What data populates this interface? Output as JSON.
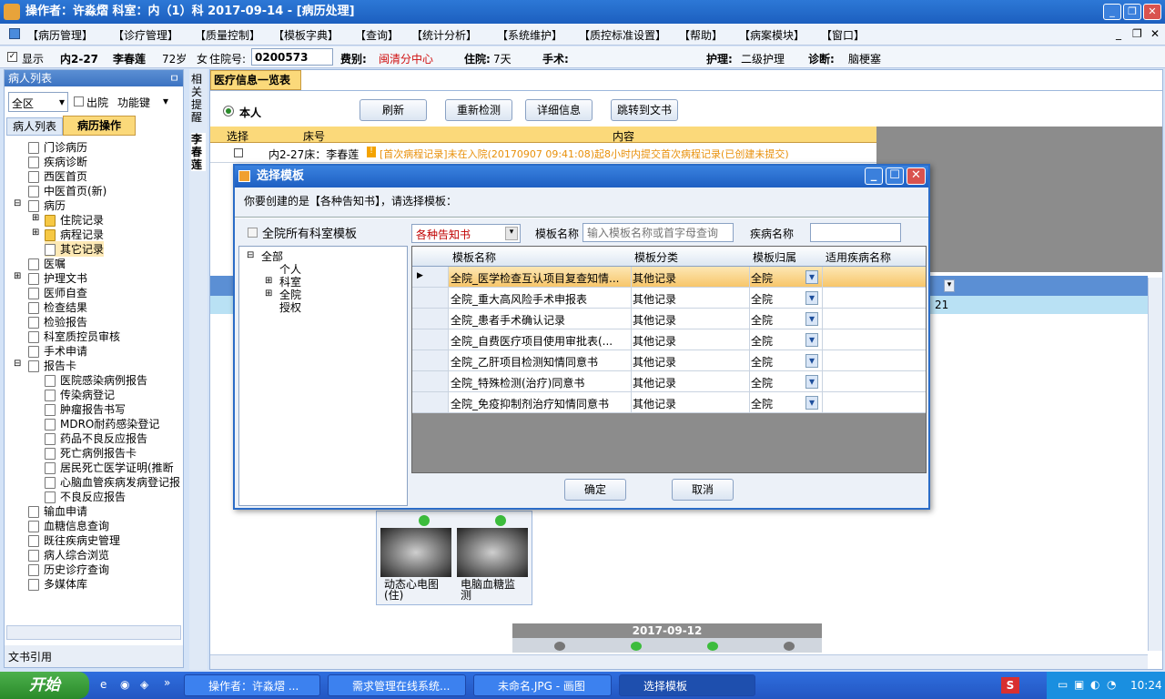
{
  "window": {
    "title": "操作者：许淼熠   科室：内（1）科   2017-09-14 - [病历处理]"
  },
  "menu": [
    "【病历管理】",
    "【诊疗管理】",
    "【质量控制】",
    "【模板字典】",
    "【查询】",
    "【统计分析】",
    "【系统维护】",
    "【质控标准设置】",
    "【帮助】",
    "【病案模块】",
    "【窗口】"
  ],
  "info": {
    "show": "显示",
    "bed": "内2-27",
    "name": "李春莲",
    "age": "72岁",
    "sex": "女",
    "inpatient_label": "住院号:",
    "inpatient_no": "0200573",
    "fee_label": "费别:",
    "fee": "闽清分中心",
    "stay_label": "住院:",
    "stay": "7天",
    "surgery_label": "手术:",
    "nursing_label": "护理:",
    "nursing": "二级护理",
    "diag_label": "诊断:",
    "diag": "脑梗塞"
  },
  "left": {
    "title": "病人列表",
    "pin": "ㅁ",
    "area": "全区",
    "discharge": "出院",
    "func": "功能键",
    "tab1": "病人列表",
    "tab2": "病历操作",
    "footer": "文书引用",
    "tree": [
      "门诊病历",
      "疾病诊断",
      "西医首页",
      "中医首页(新)",
      "病历",
      "住院记录",
      "病程记录",
      "其它记录",
      "医嘱",
      "护理文书",
      "医师自查",
      "检查结果",
      "检验报告",
      "科室质控员审核",
      "手术申请",
      "报告卡",
      "医院感染病例报告",
      "传染病登记",
      "肿瘤报告书写",
      "MDRO耐药感染登记",
      "药品不良反应报告",
      "死亡病例报告卡",
      "居民死亡医学证明(推断",
      "心脑血管疾病发病登记报",
      "不良反应报告",
      "输血申请",
      "血糖信息查询",
      "既往疾病史管理",
      "病人综合浏览",
      "历史诊疗查询",
      "多媒体库"
    ]
  },
  "vtabs": {
    "t1": "相关提醒",
    "t2": "李春莲"
  },
  "main": {
    "tab": "医疗信息一览表",
    "self": "本人",
    "buttons": [
      "刷新",
      "重新检测",
      "详细信息",
      "跳转到文书"
    ],
    "col_select": "选择",
    "col_bed": "床号",
    "col_content": "内容",
    "row_bed": "内2-27床：李春莲",
    "row_content": "[首次病程记录]未在入院(20170907  09:41:08)起8小时内提交首次病程记录(已创建未提交)",
    "val21": "21",
    "date": "2017-09-12",
    "img1": "动态心电图(住)",
    "img2": "电脑血糖监测"
  },
  "dialog": {
    "title": "选择模板",
    "prompt": "你要创建的是【各种告知书】，请选择模板：",
    "all_dept": "全院所有科室模板",
    "category": "各种告知书",
    "name_label": "模板名称",
    "name_ph": "输入模板名称或首字母查询",
    "disease_label": "疾病名称",
    "tree": [
      "全部",
      "个人",
      "科室",
      "全院",
      "授权"
    ],
    "headers": [
      "模板名称",
      "模板分类",
      "模板归属",
      "适用疾病名称"
    ],
    "rows": [
      [
        "全院_医学检查互认项目复查知情...",
        "其他记录",
        "全院"
      ],
      [
        "全院_重大高风险手术申报表",
        "其他记录",
        "全院"
      ],
      [
        "全院_患者手术确认记录",
        "其他记录",
        "全院"
      ],
      [
        "全院_自费医疗项目使用审批表(...",
        "其他记录",
        "全院"
      ],
      [
        "全院_乙肝项目检测知情同意书",
        "其他记录",
        "全院"
      ],
      [
        "全院_特殊检测(治疗)同意书",
        "其他记录",
        "全院"
      ],
      [
        "全院_免疫抑制剂治疗知情同意书",
        "其他记录",
        "全院"
      ]
    ],
    "ok": "确定",
    "cancel": "取消"
  },
  "taskbar": {
    "start": "开始",
    "tasks": [
      "操作者：许淼熠 ...",
      "需求管理在线系统...",
      "未命名.JPG - 画图",
      "选择模板"
    ],
    "time": "10:24"
  }
}
